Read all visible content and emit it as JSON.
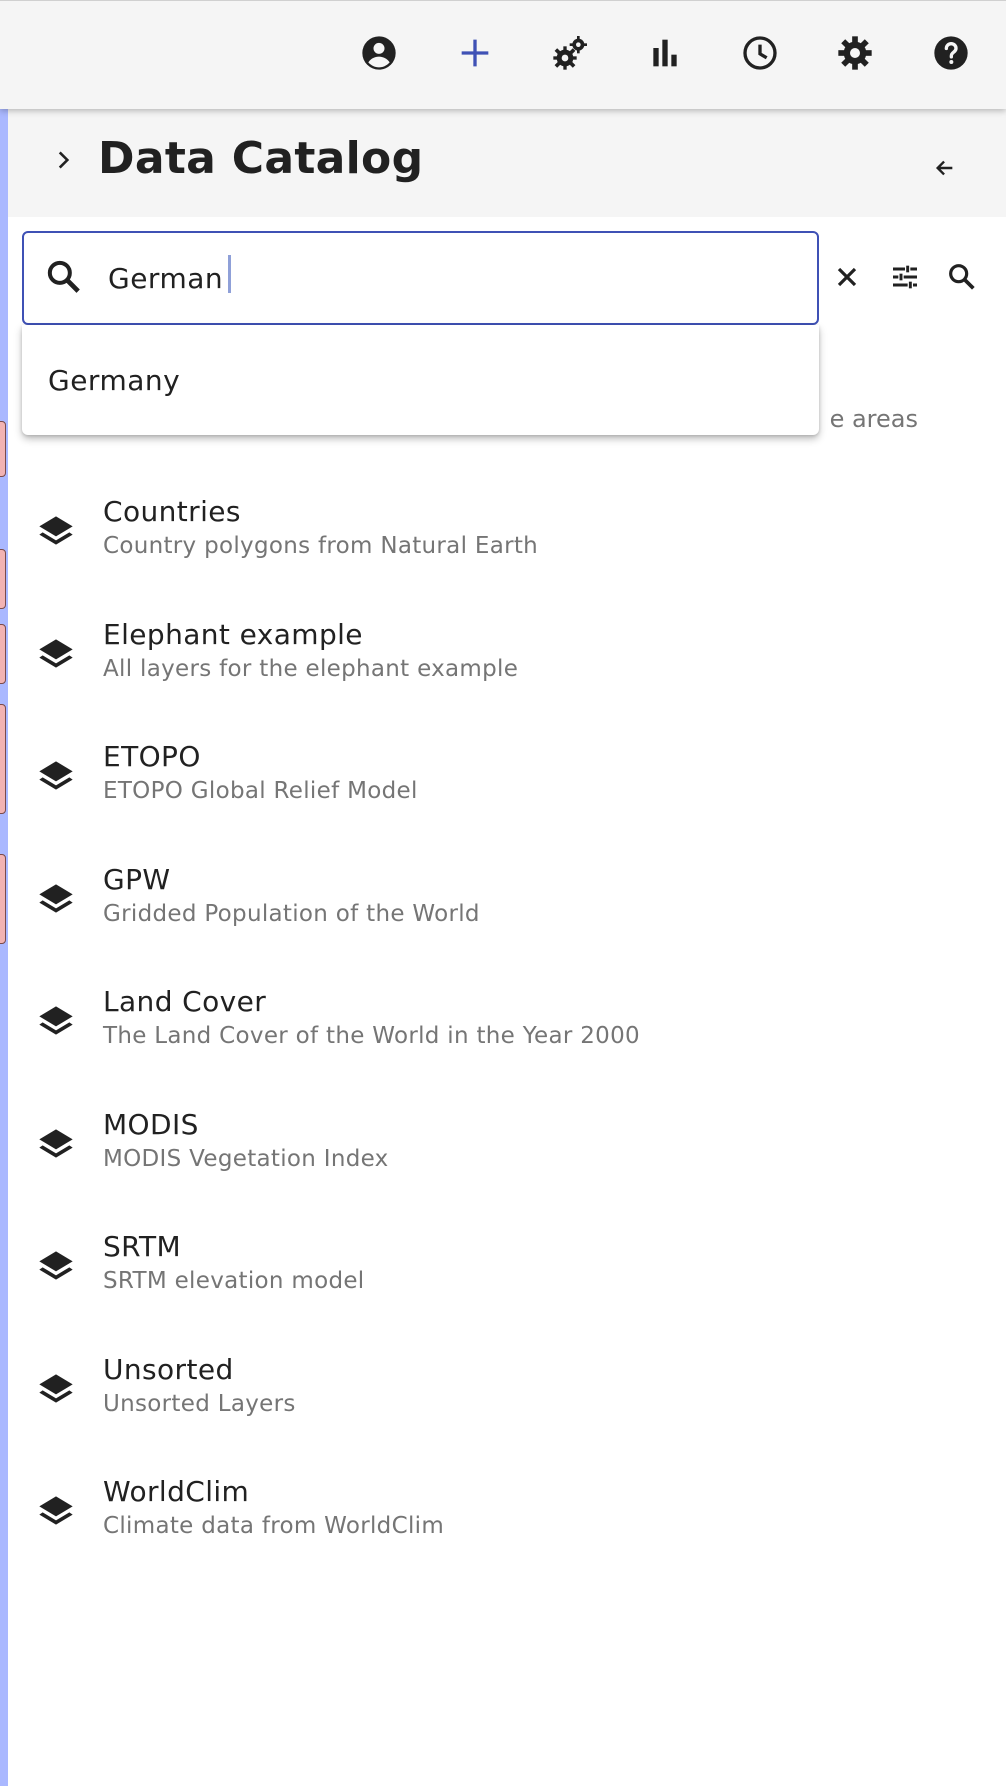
{
  "toolbar": {
    "buttons": [
      {
        "name": "account-circle-icon",
        "label": "Account"
      },
      {
        "name": "plus-icon",
        "label": "Add data"
      },
      {
        "name": "gears-icon",
        "label": "Operators"
      },
      {
        "name": "bar-chart-icon",
        "label": "Plots"
      },
      {
        "name": "clock-icon",
        "label": "Time"
      },
      {
        "name": "gear-icon",
        "label": "Settings"
      },
      {
        "name": "help-icon",
        "label": "Help"
      }
    ],
    "accent_color": "#3f51b5"
  },
  "panel": {
    "title": "Data Catalog"
  },
  "search": {
    "value": "German",
    "placeholder": ""
  },
  "autocomplete": {
    "options": [
      "Germany"
    ]
  },
  "hidden_item_desc_fragment": "e areas",
  "catalog": {
    "items": [
      {
        "title": "Countries",
        "subtitle": "Country polygons from Natural Earth"
      },
      {
        "title": "Elephant example",
        "subtitle": "All layers for the elephant example"
      },
      {
        "title": "ETOPO",
        "subtitle": "ETOPO Global Relief Model"
      },
      {
        "title": "GPW",
        "subtitle": "Gridded Population of the World"
      },
      {
        "title": "Land Cover",
        "subtitle": "The Land Cover of the World in the Year 2000"
      },
      {
        "title": "MODIS",
        "subtitle": "MODIS Vegetation Index"
      },
      {
        "title": "SRTM",
        "subtitle": "SRTM elevation model"
      },
      {
        "title": "Unsorted",
        "subtitle": "Unsorted Layers"
      },
      {
        "title": "WorldClim",
        "subtitle": "Climate data from WorldClim"
      }
    ]
  },
  "colors": {
    "panel_header_bg": "#f5f5f5",
    "subtitle_text": "#757575",
    "map_water": "#aab8ff",
    "map_country": "#f2b3b3"
  }
}
